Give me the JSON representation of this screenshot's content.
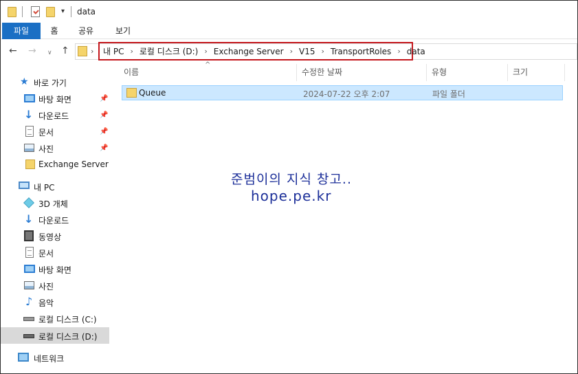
{
  "window": {
    "title": "data"
  },
  "ribbon": {
    "tabs": [
      {
        "label": "파일",
        "active": true
      },
      {
        "label": "홈"
      },
      {
        "label": "공유"
      },
      {
        "label": "보기"
      }
    ],
    "accent": "#1a6fc4"
  },
  "address": {
    "crumbs": [
      "내 PC",
      "로컬 디스크 (D:)",
      "Exchange Server",
      "V15",
      "TransportRoles",
      "data"
    ],
    "highlight_color": "#c4161c"
  },
  "sidebar": {
    "quick_access": {
      "label": "바로 가기",
      "items": [
        {
          "label": "바탕 화면",
          "icon": "desktop-icon",
          "pinned": true
        },
        {
          "label": "다운로드",
          "icon": "download-icon",
          "pinned": true
        },
        {
          "label": "문서",
          "icon": "document-icon",
          "pinned": true
        },
        {
          "label": "사진",
          "icon": "picture-icon",
          "pinned": true
        },
        {
          "label": "Exchange Server",
          "icon": "folder-icon",
          "pinned": false
        }
      ]
    },
    "this_pc": {
      "label": "내 PC",
      "items": [
        {
          "label": "3D 개체",
          "icon": "3d-objects-icon"
        },
        {
          "label": "다운로드",
          "icon": "download-icon"
        },
        {
          "label": "동영상",
          "icon": "video-icon"
        },
        {
          "label": "문서",
          "icon": "document-icon"
        },
        {
          "label": "바탕 화면",
          "icon": "desktop-icon"
        },
        {
          "label": "사진",
          "icon": "picture-icon"
        },
        {
          "label": "음악",
          "icon": "music-icon"
        },
        {
          "label": "로컬 디스크 (C:)",
          "icon": "drive-icon"
        },
        {
          "label": "로컬 디스크 (D:)",
          "icon": "drive-icon",
          "selected": true
        }
      ]
    },
    "network": {
      "label": "네트워크",
      "icon": "network-icon"
    }
  },
  "columns": {
    "name": "이름",
    "date": "수정한 날짜",
    "type": "유형",
    "size": "크기"
  },
  "files": [
    {
      "name": "Queue",
      "date": "2024-07-22 오후 2:07",
      "type": "파일 폴더",
      "size": "",
      "selected": true
    }
  ],
  "watermark": {
    "line1": "준범이의 지식 창고..",
    "line2": "hope.pe.kr",
    "color": "#1c2f99"
  }
}
